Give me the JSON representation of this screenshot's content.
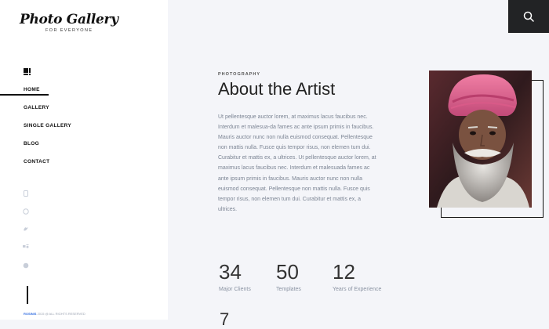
{
  "logo": {
    "title": "Photo Gallery",
    "tagline": "FOR EVERYONE"
  },
  "nav": {
    "items": [
      {
        "label": "HOME"
      },
      {
        "label": "GALLERY"
      },
      {
        "label": "SINGLE GALLERY"
      },
      {
        "label": "BLOG"
      },
      {
        "label": "CONTACT"
      }
    ]
  },
  "social_icons": [
    "pinterest-icon",
    "dribbble-icon",
    "twitter-icon",
    "behance-icon",
    "facebook-icon"
  ],
  "footer": {
    "brand": "ROSINIS",
    "copyright": "2015 @ ALL RIGHTS RESERVED"
  },
  "about": {
    "eyebrow": "PHOTOGRAPHY",
    "title": "About the Artist",
    "paragraph": "Ut pellentesque auctor lorem, at maximus lacus faucibus nec. Interdum et malesua-da fames ac ante ipsum primis in faucibus. Mauris auctor nunc non nulla euismod consequat. Pellentesque non mattis nulla. Fusce quis tempor risus, non elemen tum dui. Curabitur et mattis ex, a ultrices. Ut pellentesque auctor lorem, at maximus lacus faucibus nec. Interdum et malesuada fames ac ante ipsum primis in faucibus. Mauris auctor nunc non nulla euismod consequat. Pellentesque non mattis nulla. Fusce quis tempor risus, non elemen tum dui. Curabitur et mattis ex, a ultrices."
  },
  "stats": [
    {
      "value": "34",
      "label": "Major Clients"
    },
    {
      "value": "50",
      "label": "Templates"
    },
    {
      "value": "12",
      "label": "Years of Experience"
    }
  ],
  "next_stat_peek": "7",
  "colors": {
    "accent": "#2f6be0",
    "dark": "#222325",
    "background": "#f4f5f9"
  }
}
